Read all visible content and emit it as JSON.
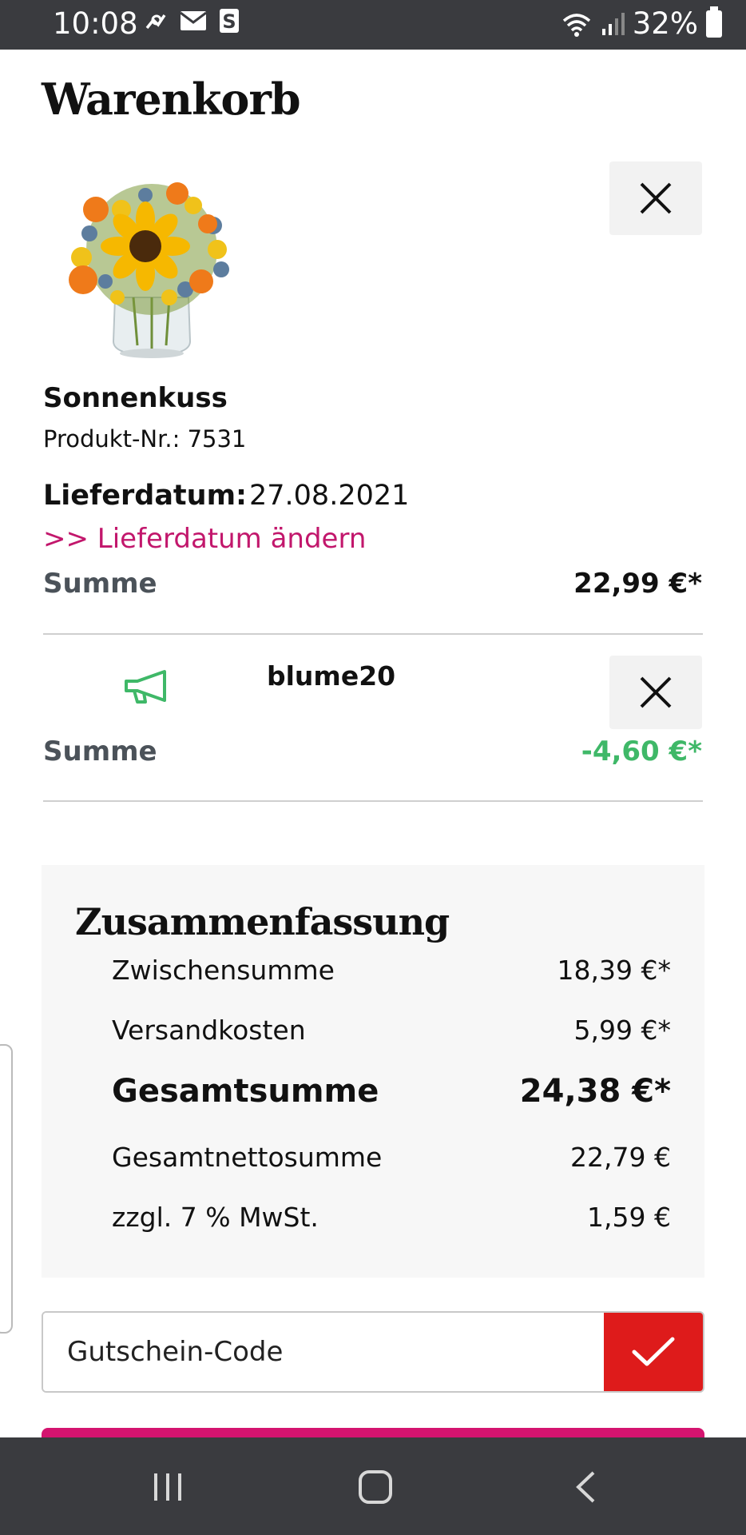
{
  "status_bar": {
    "time": "10:08",
    "battery_percent": "32%"
  },
  "page": {
    "title": "Warenkorb"
  },
  "product": {
    "name": "Sonnenkuss",
    "number_label": "Produkt-Nr.: 7531",
    "delivery_label": "Lieferdatum:",
    "delivery_date": "27.08.2021",
    "change_delivery_link": ">> Lieferdatum ändern",
    "sum_label": "Summe",
    "sum_value": "22,99 €*"
  },
  "coupon": {
    "code": "blume20",
    "sum_label": "Summe",
    "sum_value": "-4,60 €*"
  },
  "summary": {
    "title": "Zusammenfassung",
    "rows": [
      {
        "label": "Zwischensumme",
        "value": "18,39 €*"
      },
      {
        "label": "Versandkosten",
        "value": "5,99 €*"
      },
      {
        "label": "Gesamtsumme",
        "value": "24,38 €*"
      },
      {
        "label": "Gesamtnettosumme",
        "value": "22,79 €"
      },
      {
        "label": "zzgl. 7 % MwSt.",
        "value": "1,59 €"
      }
    ]
  },
  "voucher": {
    "placeholder": "Gutschein-Code"
  },
  "colors": {
    "accent_link": "#c2176c",
    "discount_green": "#3fb868",
    "apply_red": "#de1b1b",
    "primary_pink": "#d4146f"
  },
  "icons": {
    "close": "close-icon",
    "coupon": "megaphone-icon",
    "apply": "checkmark-icon"
  }
}
